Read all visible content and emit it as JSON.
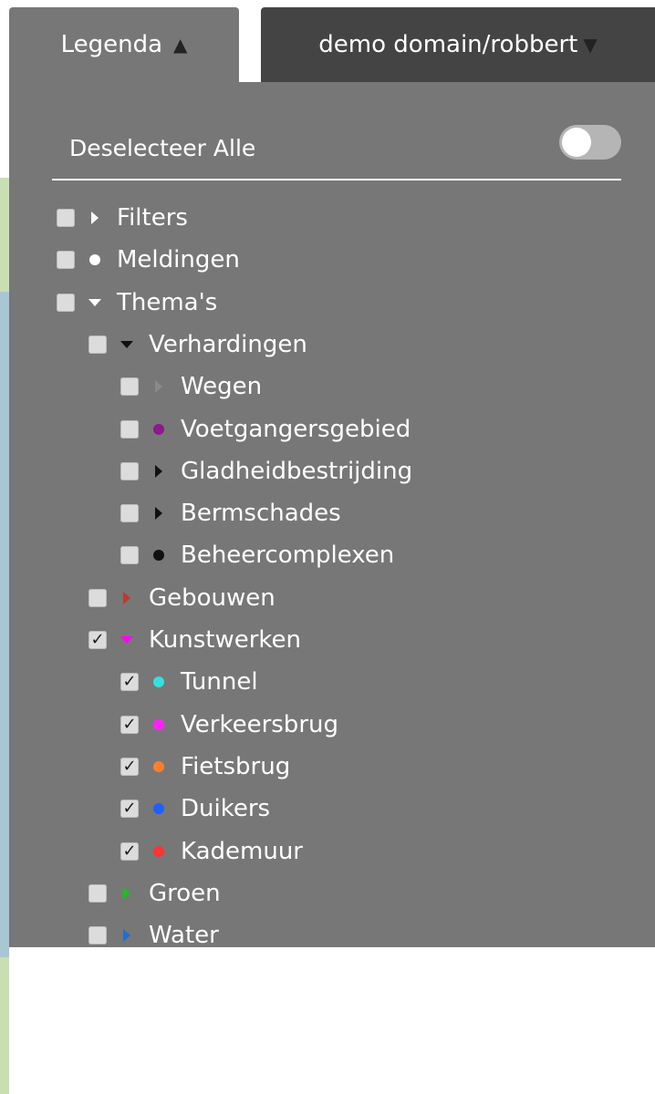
{
  "tabs": {
    "legend": {
      "label": "Legenda",
      "caret": "▲"
    },
    "domain": {
      "label": "demo domain/robbert",
      "caret": "▼"
    }
  },
  "panel": {
    "deselect_label": "Deselecteer Alle",
    "toggle_on": false
  },
  "tree": [
    {
      "label": "Filters",
      "checked": false,
      "marker": "triangle-right",
      "color": "#ffffff"
    },
    {
      "label": "Meldingen",
      "checked": false,
      "marker": "dot",
      "color": "#ffffff"
    },
    {
      "label": "Thema's",
      "checked": false,
      "marker": "triangle-down",
      "color": "#ffffff"
    },
    {
      "label": "Verhardingen",
      "checked": false,
      "marker": "triangle-down",
      "color": "#111111"
    },
    {
      "label": "Wegen",
      "checked": false,
      "marker": "triangle-right",
      "color": "#8a8a8a"
    },
    {
      "label": "Voetgangersgebied",
      "checked": false,
      "marker": "dot",
      "color": "#8b1a8b"
    },
    {
      "label": "Gladheidbestrijding",
      "checked": false,
      "marker": "triangle-right",
      "color": "#111111"
    },
    {
      "label": "Bermschades",
      "checked": false,
      "marker": "triangle-right",
      "color": "#111111"
    },
    {
      "label": "Beheercomplexen",
      "checked": false,
      "marker": "dot",
      "color": "#111111"
    },
    {
      "label": "Gebouwen",
      "checked": false,
      "marker": "triangle-right",
      "color": "#c0392b"
    },
    {
      "label": "Kunstwerken",
      "checked": true,
      "marker": "triangle-down",
      "color": "#ff00ff"
    },
    {
      "label": "Tunnel",
      "checked": true,
      "marker": "dot",
      "color": "#33e0e0"
    },
    {
      "label": "Verkeersbrug",
      "checked": true,
      "marker": "dot",
      "color": "#ff22ff"
    },
    {
      "label": "Fietsbrug",
      "checked": true,
      "marker": "dot",
      "color": "#ff7f2a"
    },
    {
      "label": "Duikers",
      "checked": true,
      "marker": "dot",
      "color": "#1f5fff"
    },
    {
      "label": "Kademuur",
      "checked": true,
      "marker": "dot",
      "color": "#ff3333"
    },
    {
      "label": "Groen",
      "checked": false,
      "marker": "triangle-right",
      "color": "#22bb22"
    },
    {
      "label": "Water",
      "checked": false,
      "marker": "triangle-right",
      "color": "#1f6fcf"
    }
  ]
}
